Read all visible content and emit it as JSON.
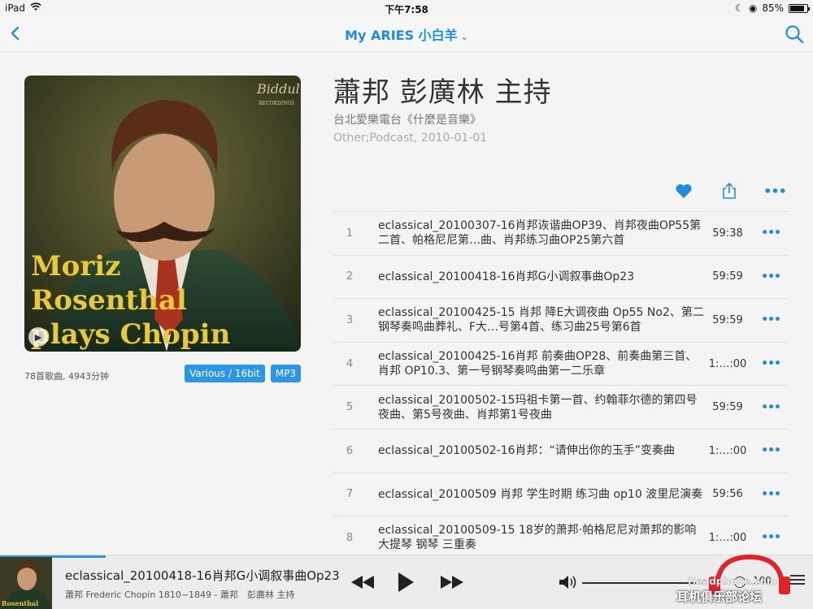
{
  "status_bar": {
    "device": "iPad",
    "time": "下午7:58",
    "battery_pct": "85%",
    "battery_level": 0.85
  },
  "nav": {
    "title": "My ARIES 小白羊",
    "back_icon": "chevron-left-icon",
    "search_icon": "search-icon"
  },
  "album": {
    "title": "蕭邦 彭廣林 主持",
    "artist": "台北愛樂電台《什麼是音樂》",
    "meta": "Other;Podcast, 2010-01-01",
    "summary": "78首歌曲, 4943分钟",
    "badges": [
      "Various / 16bit",
      "MP3"
    ],
    "cover_text": {
      "line1": "Moriz",
      "line2": "Rosenthal",
      "line3": "plays Chopin",
      "label": "Biddulph",
      "label_sub": "RECORDINGS"
    }
  },
  "actions": {
    "favorite_icon": "heart-icon",
    "share_icon": "share-icon",
    "more_icon": "more-icon"
  },
  "tracks": [
    {
      "num": "1",
      "title": "eclassical_20100307-16肖邦诙谐曲OP39、肖邦夜曲OP55第二首、帕格尼尼第…曲、肖邦练习曲OP25第六首",
      "duration": "59:38"
    },
    {
      "num": "2",
      "title": "eclassical_20100418-16肖邦G小调叙事曲Op23",
      "duration": "59:59"
    },
    {
      "num": "3",
      "title": "eclassical_20100425-15 肖邦 降E大调夜曲 Op55 No2、第二钢琴奏鸣曲葬礼、F大…号第4首、练习曲25号第6首",
      "duration": "59:59"
    },
    {
      "num": "4",
      "title": "eclassical_20100425-16肖邦 前奏曲OP28、前奏曲第三首、肖邦 OP10.3、第一号钢琴奏鸣曲第一二乐章",
      "duration": "1:…:00"
    },
    {
      "num": "5",
      "title": "eclassical_20100502-15玛祖卡第一首、约翰菲尔德的第四号夜曲、第5号夜曲、肖邦第1号夜曲",
      "duration": "59:59"
    },
    {
      "num": "6",
      "title": "eclassical_20100502-16肖邦：“请伸出你的玉手”变奏曲",
      "duration": "1:…:00"
    },
    {
      "num": "7",
      "title": "eclassical_20100509 肖邦 学生时期 练习曲 op10 波里尼演奏",
      "duration": "59:56"
    },
    {
      "num": "8",
      "title": "eclassical_20100509-15 18岁的萧邦·帕格尼尼对萧邦的影响　　大提琴 钢琴 三重奏",
      "duration": "1:…:00"
    }
  ],
  "now_playing": {
    "title": "eclassical_20100418-16肖邦G小调叙事曲Op23",
    "subtitle": "蕭邦 Frederic Chopin 1810~1849 - 蕭邦　彭廣林 主持",
    "progress": 0.13,
    "volume_value": "100",
    "volume_level": 1.0
  },
  "watermark": {
    "text": "耳机俱乐部论坛",
    "small": "Headphone.com"
  },
  "colors": {
    "accent": "#1f8ce0",
    "badge": "#2c95e6",
    "background": "#f4f4f4"
  }
}
